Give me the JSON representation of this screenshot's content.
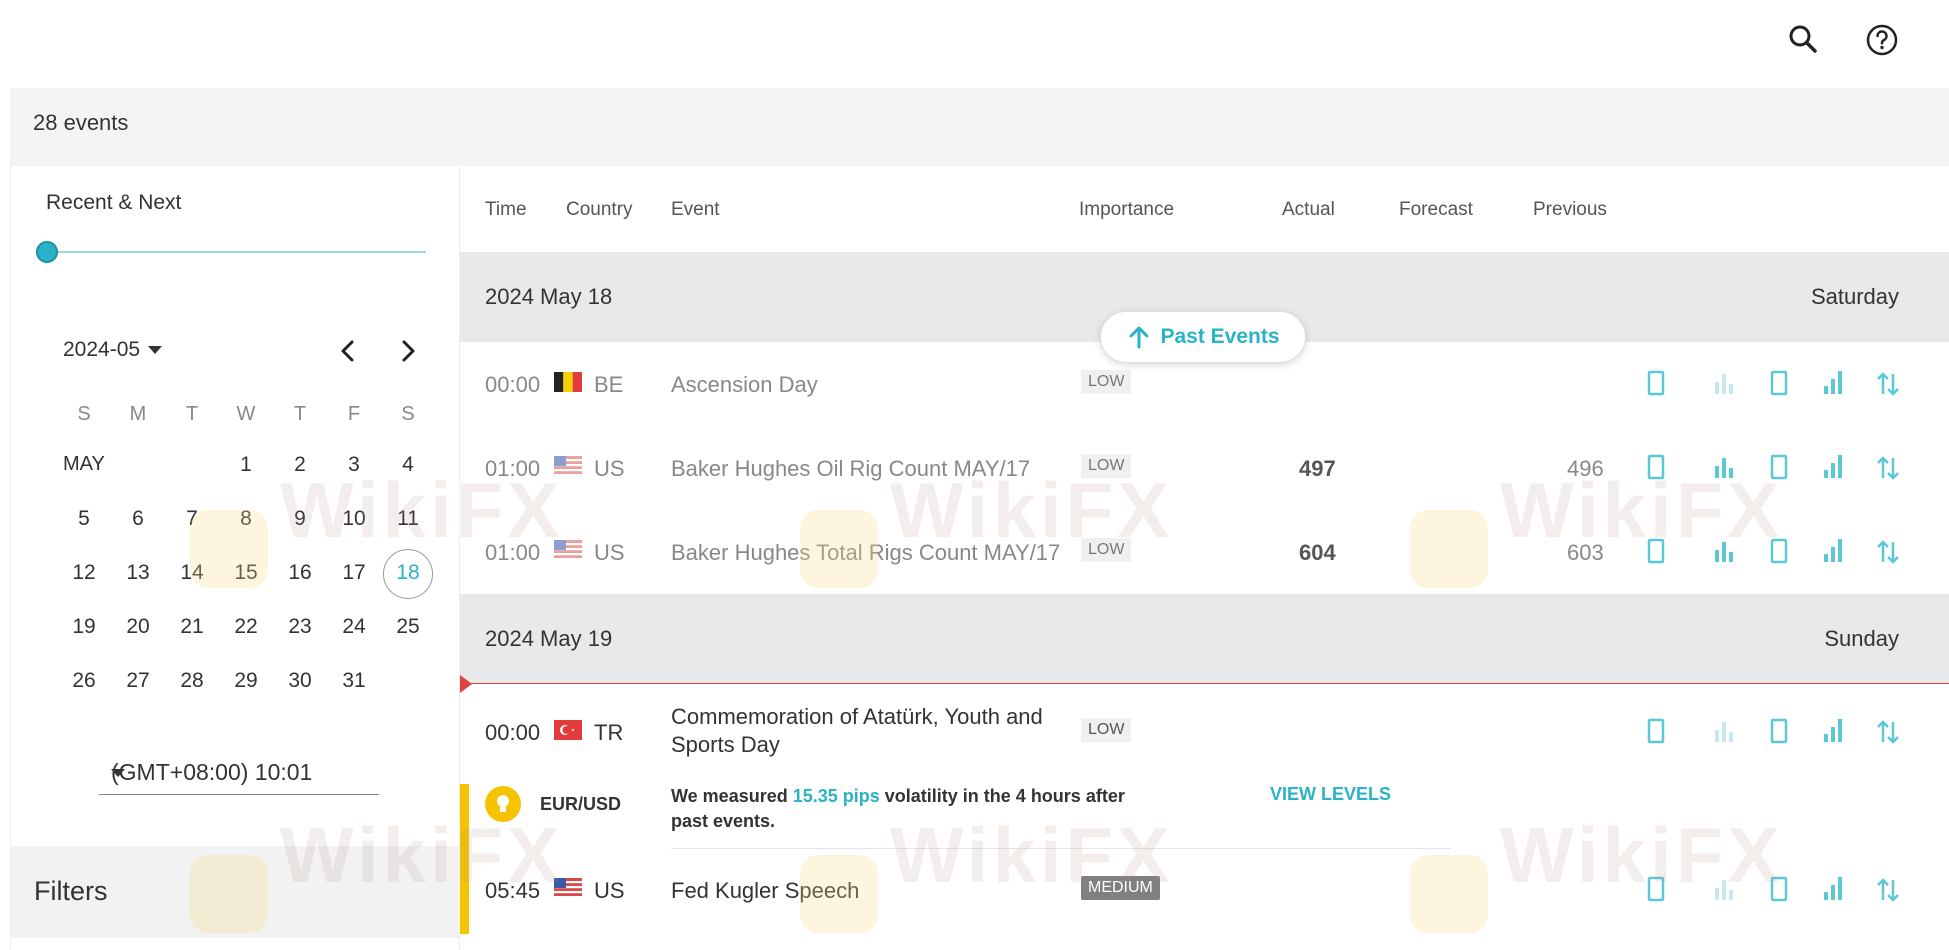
{
  "header": {
    "search_icon": "search-icon",
    "help_icon": "help-icon"
  },
  "summary": {
    "events_count": "28 events"
  },
  "sidebar": {
    "range_label": "Recent & Next",
    "month_label": "2024-05",
    "weekdays": [
      "S",
      "M",
      "T",
      "W",
      "T",
      "F",
      "S"
    ],
    "month_name": "MAY",
    "week1": [
      "1",
      "2",
      "3",
      "4"
    ],
    "week2": [
      "5",
      "6",
      "7",
      "8",
      "9",
      "10",
      "11"
    ],
    "week3": [
      "12",
      "13",
      "14",
      "15",
      "16",
      "17",
      "18"
    ],
    "week4": [
      "19",
      "20",
      "21",
      "22",
      "23",
      "24",
      "25"
    ],
    "week5": [
      "26",
      "27",
      "28",
      "29",
      "30",
      "31"
    ],
    "selected_day": "18",
    "timezone": "(GMT+08:00) 10:01",
    "filters_label": "Filters"
  },
  "table": {
    "columns": {
      "time": "Time",
      "country": "Country",
      "event": "Event",
      "importance": "Importance",
      "actual": "Actual",
      "forecast": "Forecast",
      "previous": "Previous"
    },
    "past_events_label": "Past Events",
    "day1": {
      "date": "2024 May 18",
      "weekday": "Saturday",
      "events": [
        {
          "time": "00:00",
          "country": "BE",
          "event": "Ascension Day",
          "importance": "LOW",
          "actual": "",
          "forecast": "",
          "previous": ""
        },
        {
          "time": "01:00",
          "country": "US",
          "event": "Baker Hughes Oil Rig Count MAY/17",
          "importance": "LOW",
          "actual": "497",
          "forecast": "",
          "previous": "496"
        },
        {
          "time": "01:00",
          "country": "US",
          "event": "Baker Hughes Total Rigs Count MAY/17",
          "importance": "LOW",
          "actual": "604",
          "forecast": "",
          "previous": "603"
        }
      ]
    },
    "day2": {
      "date": "2024 May 19",
      "weekday": "Sunday",
      "events": [
        {
          "time": "00:00",
          "country": "TR",
          "event_line1": "Commemoration of Atatürk, Youth and",
          "event_line2": "Sports Day",
          "importance": "LOW"
        },
        {
          "time": "05:45",
          "country": "US",
          "event": "Fed Kugler Speech",
          "importance": "MEDIUM"
        }
      ]
    },
    "insight": {
      "pair": "EUR/USD",
      "msg_prefix": "We measured ",
      "pips": "15.35 pips",
      "msg_suffix": " volatility in the 4 hours after past events.",
      "view_levels": "VIEW LEVELS"
    }
  },
  "colors": {
    "accent": "#2ab3c8",
    "now_line": "#e04040",
    "insight_bar": "#f5c400"
  }
}
